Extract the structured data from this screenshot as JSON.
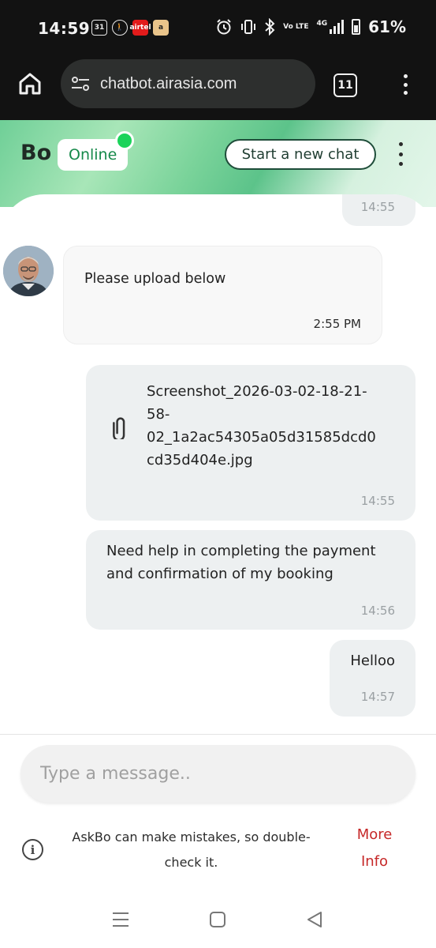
{
  "status_bar": {
    "time": "14:59",
    "app_icons": [
      {
        "name": "calendar-icon",
        "text": "31"
      },
      {
        "name": "fitness-icon",
        "text": "🚶"
      },
      {
        "name": "airtel-icon",
        "text": "airtel"
      },
      {
        "name": "amazon-icon",
        "text": "a"
      }
    ],
    "network": "4G",
    "volte": "Vo LTE",
    "battery": "61%"
  },
  "browser": {
    "url": "chatbot.airasia.com",
    "tab_count": "11"
  },
  "chat_header": {
    "bot_name": "Bo",
    "status": "Online",
    "new_chat_label": "Start a new chat"
  },
  "messages": [
    {
      "from": "user",
      "text": "",
      "time": "14:55"
    },
    {
      "from": "bot",
      "text": "Please upload below",
      "time": "2:55 PM"
    },
    {
      "from": "user",
      "type": "file",
      "text": "Screenshot_2026-03-02-18-21-58-02_1a2ac54305a05d31585dcd0cd35d404e.jpg",
      "lines": [
        "Screenshot_2026-03-02-18-21-",
        "58-",
        "02_1a2ac54305a05d31585dcd0",
        "cd35d404e.jpg"
      ],
      "time": "14:55"
    },
    {
      "from": "user",
      "text": "Need help in completing the payment and confirmation of my booking",
      "lines": [
        "Need help in completing the payment",
        "and confirmation of my booking"
      ],
      "time": "14:56"
    },
    {
      "from": "user",
      "text": "Helloo",
      "time": "14:57"
    }
  ],
  "composer": {
    "placeholder": "Type a message.."
  },
  "footer": {
    "disclaimer_lines": [
      "AskBo can make mistakes, so double-",
      "check it."
    ],
    "more_info_lines": [
      "More",
      "Info"
    ]
  },
  "colors": {
    "online_green": "#1bd35a",
    "more_info_red": "#c62828",
    "user_bubble": "#edf0f1"
  }
}
